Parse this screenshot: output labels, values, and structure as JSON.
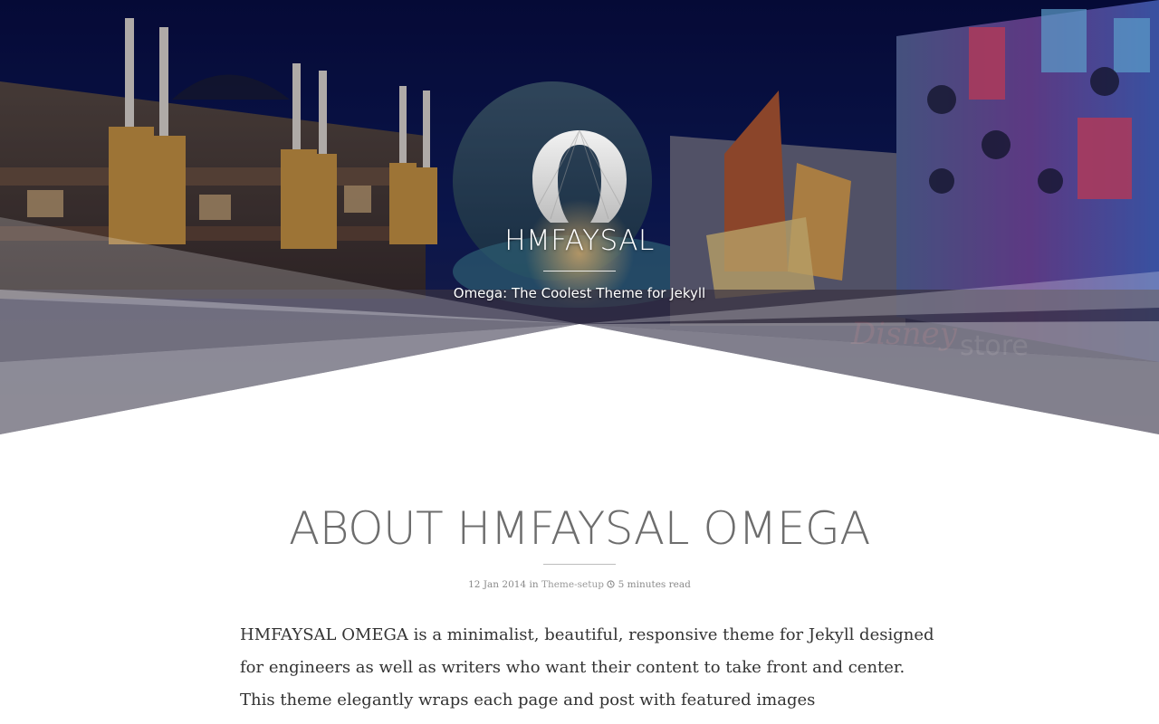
{
  "site": {
    "title": "HMFAYSAL",
    "tagline": "Omega: The Coolest Theme for Jekyll"
  },
  "post": {
    "title": "ABOUT HMFAYSAL OMEGA",
    "meta": {
      "date": "12 Jan 2014",
      "in_word": "in",
      "category": "Theme-setup",
      "read_time": "5 minutes read"
    },
    "body_lines": [
      "HMFAYSAL OMEGA is a minimalist, beautiful, responsive theme for Jekyll designed",
      "for engineers as well as writers who want their content to take front and center.",
      "This theme elegantly wraps each page and post with featured images"
    ]
  },
  "icons": {
    "logo": "omega-logo-icon",
    "clock": "clock-icon"
  },
  "colors": {
    "hero_sky": "#0b1240",
    "title_text": "#6d6d6d",
    "body_text": "#333333",
    "meta_text": "#8a8a8a"
  }
}
